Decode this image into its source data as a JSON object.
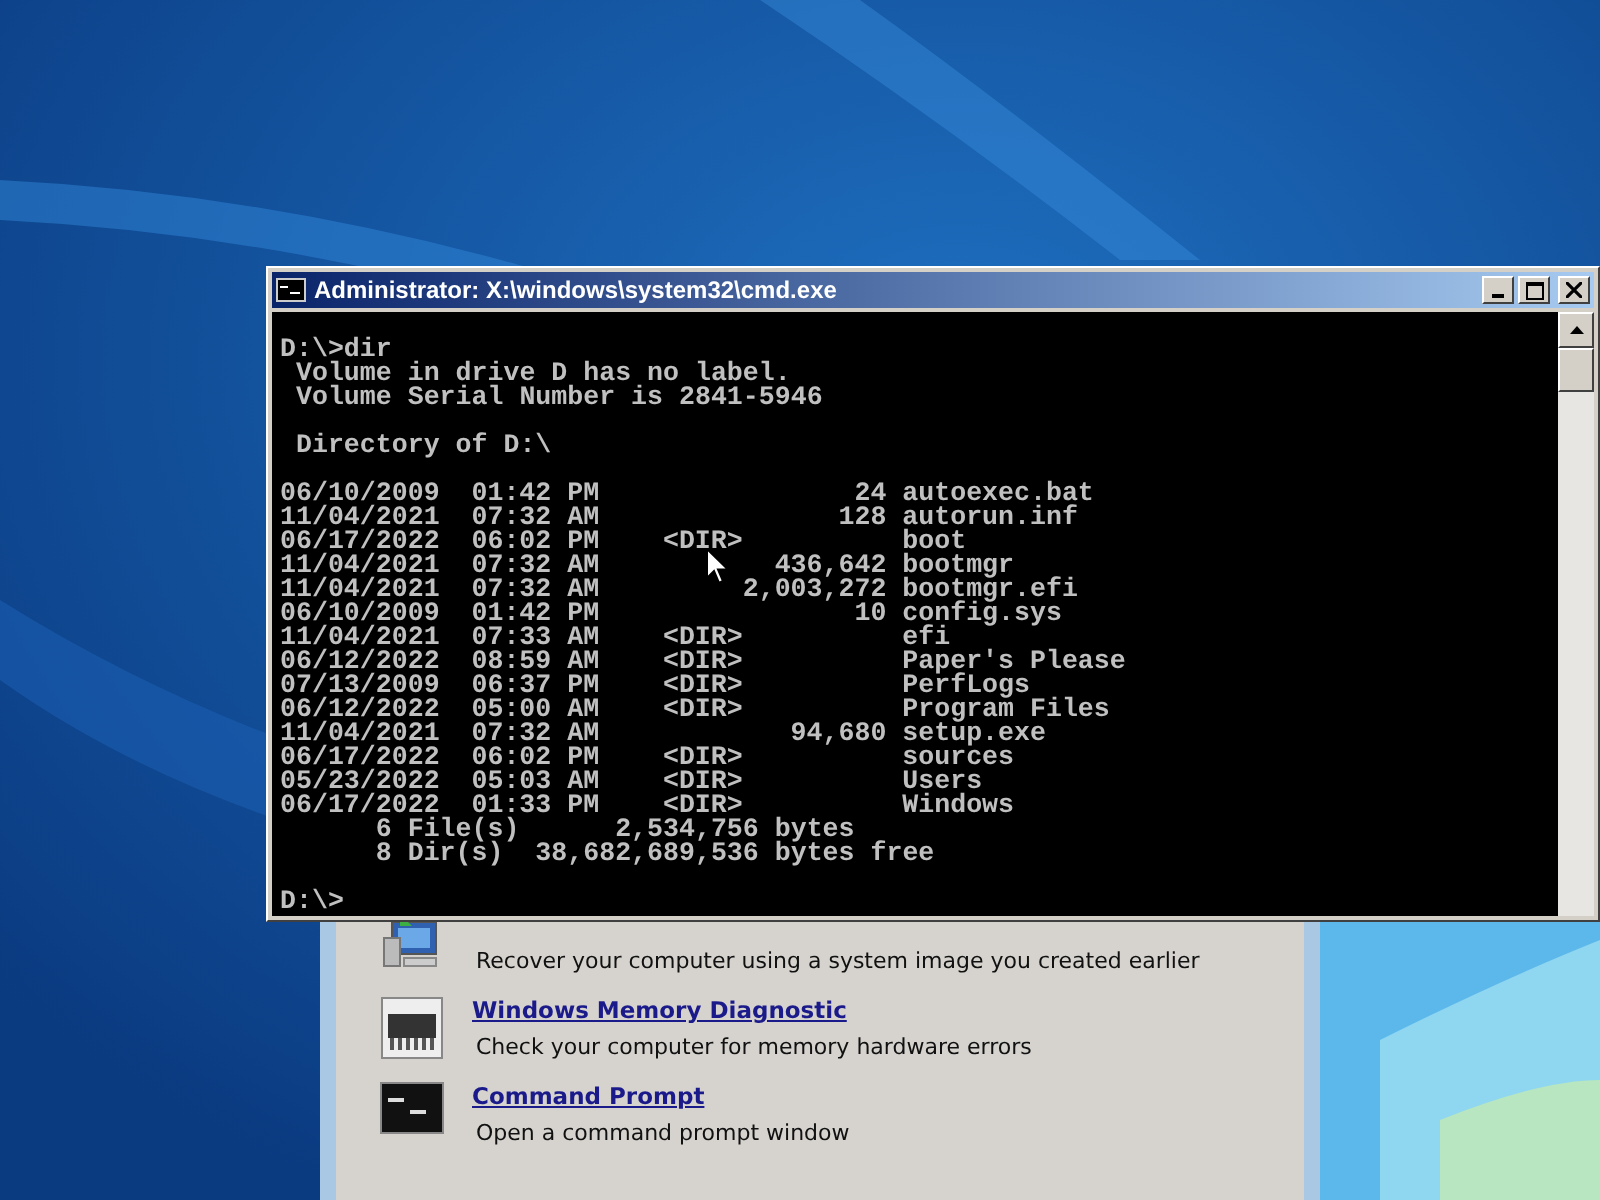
{
  "cmd_window": {
    "title": "Administrator: X:\\windows\\system32\\cmd.exe",
    "command_line": "D:\\>dir",
    "info_lines": [
      " Volume in drive D has no label.",
      " Volume Serial Number is 2841-5946"
    ],
    "directory_header": " Directory of D:\\",
    "entries": [
      {
        "date": "06/10/2009",
        "time": "01:42 PM",
        "size": "24",
        "name": "autoexec.bat"
      },
      {
        "date": "11/04/2021",
        "time": "07:32 AM",
        "size": "128",
        "name": "autorun.inf"
      },
      {
        "date": "06/17/2022",
        "time": "06:02 PM",
        "dir": "<DIR>",
        "name": "boot"
      },
      {
        "date": "11/04/2021",
        "time": "07:32 AM",
        "size": "436,642",
        "name": "bootmgr"
      },
      {
        "date": "11/04/2021",
        "time": "07:32 AM",
        "size": "2,003,272",
        "name": "bootmgr.efi"
      },
      {
        "date": "06/10/2009",
        "time": "01:42 PM",
        "size": "10",
        "name": "config.sys"
      },
      {
        "date": "11/04/2021",
        "time": "07:33 AM",
        "dir": "<DIR>",
        "name": "efi"
      },
      {
        "date": "06/12/2022",
        "time": "08:59 AM",
        "dir": "<DIR>",
        "name": "Paper's Please"
      },
      {
        "date": "07/13/2009",
        "time": "06:37 PM",
        "dir": "<DIR>",
        "name": "PerfLogs"
      },
      {
        "date": "06/12/2022",
        "time": "05:00 AM",
        "dir": "<DIR>",
        "name": "Program Files"
      },
      {
        "date": "11/04/2021",
        "time": "07:32 AM",
        "size": "94,680",
        "name": "setup.exe"
      },
      {
        "date": "06/17/2022",
        "time": "06:02 PM",
        "dir": "<DIR>",
        "name": "sources"
      },
      {
        "date": "05/23/2022",
        "time": "05:03 AM",
        "dir": "<DIR>",
        "name": "Users"
      },
      {
        "date": "06/17/2022",
        "time": "01:33 PM",
        "dir": "<DIR>",
        "name": "Windows"
      }
    ],
    "summary": [
      "      6 File(s)      2,534,756 bytes",
      "      8 Dir(s)  38,682,689,536 bytes free"
    ],
    "prompt": "D:\\>"
  },
  "recovery_options": [
    {
      "description": "Recover your computer using a system image you created earlier"
    },
    {
      "title": "Windows Memory Diagnostic",
      "description": "Check your computer for memory hardware errors"
    },
    {
      "title": "Command Prompt",
      "description": "Open a command prompt window"
    }
  ]
}
